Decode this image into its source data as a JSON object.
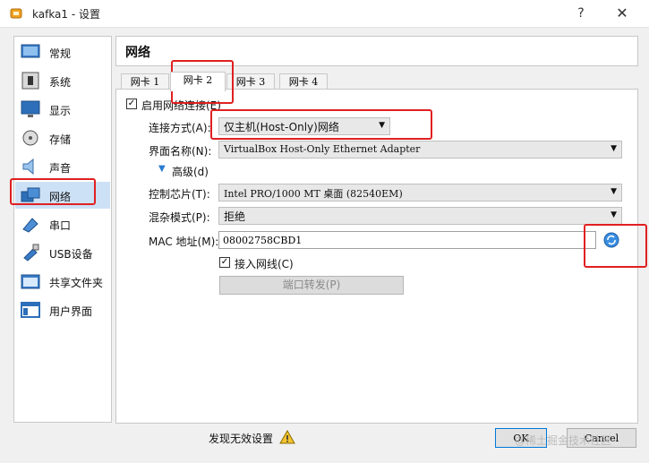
{
  "window": {
    "title": "kafka1 - 设置",
    "help": "?",
    "close": "✕"
  },
  "sidebar": {
    "items": [
      {
        "label": "常规",
        "icon": "general-icon"
      },
      {
        "label": "系统",
        "icon": "system-icon"
      },
      {
        "label": "显示",
        "icon": "display-icon"
      },
      {
        "label": "存储",
        "icon": "storage-icon"
      },
      {
        "label": "声音",
        "icon": "audio-icon"
      },
      {
        "label": "网络",
        "icon": "network-icon",
        "selected": true
      },
      {
        "label": "串口",
        "icon": "serial-port-icon"
      },
      {
        "label": "USB设备",
        "icon": "usb-icon"
      },
      {
        "label": "共享文件夹",
        "icon": "shared-folder-icon"
      },
      {
        "label": "用户界面",
        "icon": "user-interface-icon"
      }
    ]
  },
  "section": {
    "title": "网络"
  },
  "tabs": [
    {
      "label": "网卡 1"
    },
    {
      "label": "网卡 2",
      "active": true
    },
    {
      "label": "网卡 3"
    },
    {
      "label": "网卡 4"
    }
  ],
  "adapter": {
    "enable_label": "启用网络连接(E)",
    "enable_checked": true,
    "attached_label": "连接方式(A):",
    "attached_value": "仅主机(Host-Only)网络",
    "name_label": "界面名称(N):",
    "name_value": "VirtualBox Host-Only Ethernet Adapter",
    "advanced_label": "高级(d)",
    "chip_label": "控制芯片(T):",
    "chip_value": "Intel PRO/1000 MT 桌面 (82540EM)",
    "promisc_label": "混杂模式(P):",
    "promisc_value": "拒绝",
    "mac_label": "MAC 地址(M):",
    "mac_value": "08002758CBD1",
    "cable_label": "接入网线(C)",
    "cable_checked": true,
    "port_forward_label": "端口转发(P)"
  },
  "footer": {
    "invalid_settings": "发现无效设置",
    "ok": "OK",
    "cancel": "Cancel"
  },
  "watermark": "@稀土掘金技术社区",
  "colors": {
    "highlight": "#e02020",
    "selected_bg": "#cde1f6"
  }
}
